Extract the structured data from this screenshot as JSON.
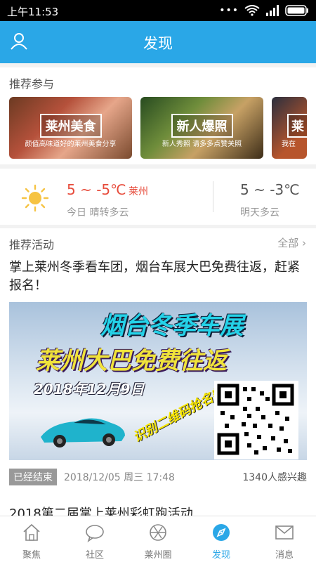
{
  "status_bar": {
    "time": "上午11:53",
    "icons": [
      "dots-icon",
      "wifi-icon",
      "signal-icon",
      "battery-icon"
    ]
  },
  "header": {
    "title": "发现",
    "user_icon": "user-icon",
    "color": "#2aa7e7"
  },
  "recommend": {
    "title": "推荐参与",
    "cards": [
      {
        "tag": "莱州美食",
        "sub": "颜值高味道好的莱州美食分享"
      },
      {
        "tag": "新人爆照",
        "sub": "新人秀照 请多多点赞关照"
      },
      {
        "tag": "莱",
        "sub": "我在"
      }
    ]
  },
  "weather": {
    "today": {
      "temp": "5 ~ -5℃",
      "city": "莱州",
      "desc": "今日 晴转多云",
      "icon": "sun-icon"
    },
    "tomorrow": {
      "temp": "5 ~ -3℃",
      "desc": "明天多云"
    }
  },
  "activities": {
    "title": "推荐活动",
    "all_label": "全部",
    "item": {
      "title": "掌上莱州冬季看车团，烟台车展大巴免费往返，赶紧报名！",
      "banner": {
        "line1": "烟台冬季车展",
        "line2": "莱州大巴免费往返",
        "line3": "2018年12月9日",
        "scan": "识别二维码抢名额"
      },
      "status": "已经结束",
      "date": "2018/12/05 周三 17:48",
      "interest": "1340人感兴趣"
    },
    "next_title": "2018第二届掌上莱州彩虹跑活动"
  },
  "tabbar": {
    "active_color": "#2aa7e7",
    "tabs": [
      {
        "label": "聚焦",
        "icon": "home-icon"
      },
      {
        "label": "社区",
        "icon": "chat-icon"
      },
      {
        "label": "莱州圈",
        "icon": "aperture-icon"
      },
      {
        "label": "发现",
        "icon": "compass-icon",
        "active": true
      },
      {
        "label": "消息",
        "icon": "mail-icon"
      }
    ]
  }
}
